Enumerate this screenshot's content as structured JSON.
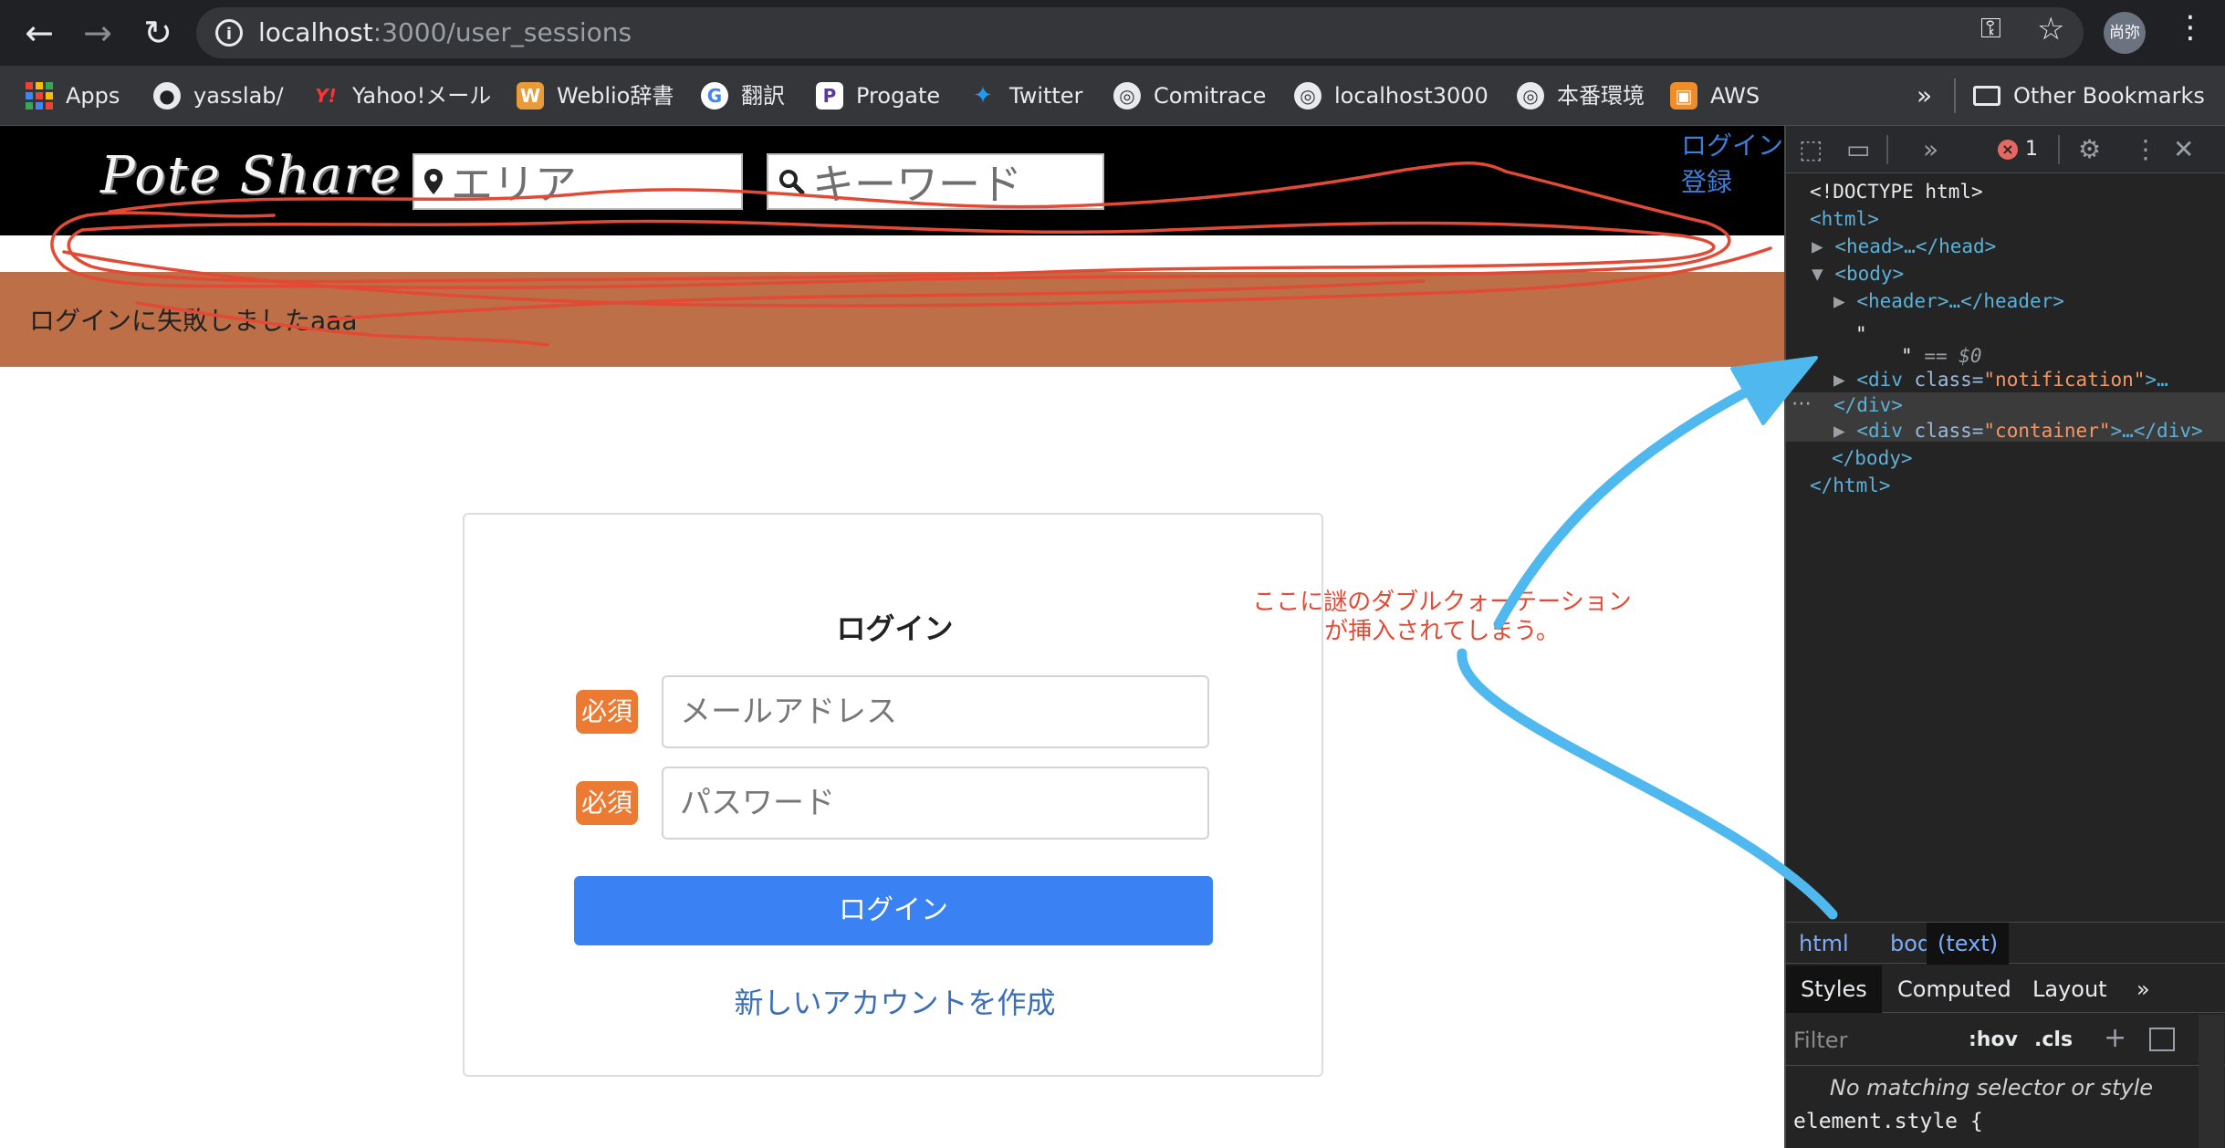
{
  "browser": {
    "url_host": "localhost",
    "url_path": ":3000/user_sessions",
    "profile_label": "尚弥",
    "bookmarks": [
      {
        "label": "Apps"
      },
      {
        "label": "yasslab/"
      },
      {
        "label": "Yahoo!メール"
      },
      {
        "label": "Weblio辞書"
      },
      {
        "label": "翻訳"
      },
      {
        "label": "Progate"
      },
      {
        "label": "Twitter"
      },
      {
        "label": "Comitrace"
      },
      {
        "label": "localhost3000"
      },
      {
        "label": "本番環境"
      },
      {
        "label": "AWS"
      }
    ],
    "more_bookmarks": "»",
    "other_bookmarks": "Other Bookmarks"
  },
  "site": {
    "logo": "Pote Share",
    "area_placeholder": "エリア",
    "keyword_placeholder": "キーワード",
    "login_link": "ログイン",
    "register_link": "登録",
    "notification": "ログインに失敗しましたaaa"
  },
  "login": {
    "title": "ログイン",
    "required_badge": "必須",
    "email_placeholder": "メールアドレス",
    "password_placeholder": "パスワード",
    "submit": "ログイン",
    "signup_link": "新しいアカウントを作成"
  },
  "annotation": {
    "line1": "ここに謎のダブルクォーテーション",
    "line2": "が挿入されてしまう。",
    "red_color": "#e34a35",
    "arrow_color": "#4fb9ef"
  },
  "devtools": {
    "error_count": "1",
    "tree": {
      "doctype": "<!DOCTYPE html>",
      "html_open": "<html>",
      "head": "<head>…</head>",
      "body_open": "<body>",
      "header": "<header>…</header>",
      "text_node_quote_open": "\"",
      "text_node_quote_close": "\"",
      "text_node_suffix": "== $0",
      "div_notification_tag": "<div",
      "div_notification_attr": "class=",
      "div_notification_val": "\"notification\"",
      "div_notification_tail": ">…",
      "div_close": "</div>",
      "div_container_tag": "<div",
      "div_container_attr": "class=",
      "div_container_val": "\"container\"",
      "div_container_tail": ">…</div>",
      "body_close": "</body>",
      "html_close": "</html>"
    },
    "breadcrumbs": [
      "html",
      "body",
      "(text)"
    ],
    "tabs": [
      "Styles",
      "Computed",
      "Layout"
    ],
    "tabs_more": "»",
    "filter_placeholder": "Filter",
    "hov": ":hov",
    "cls": ".cls",
    "no_match": "No matching selector or style",
    "element_style": "element.style {"
  }
}
